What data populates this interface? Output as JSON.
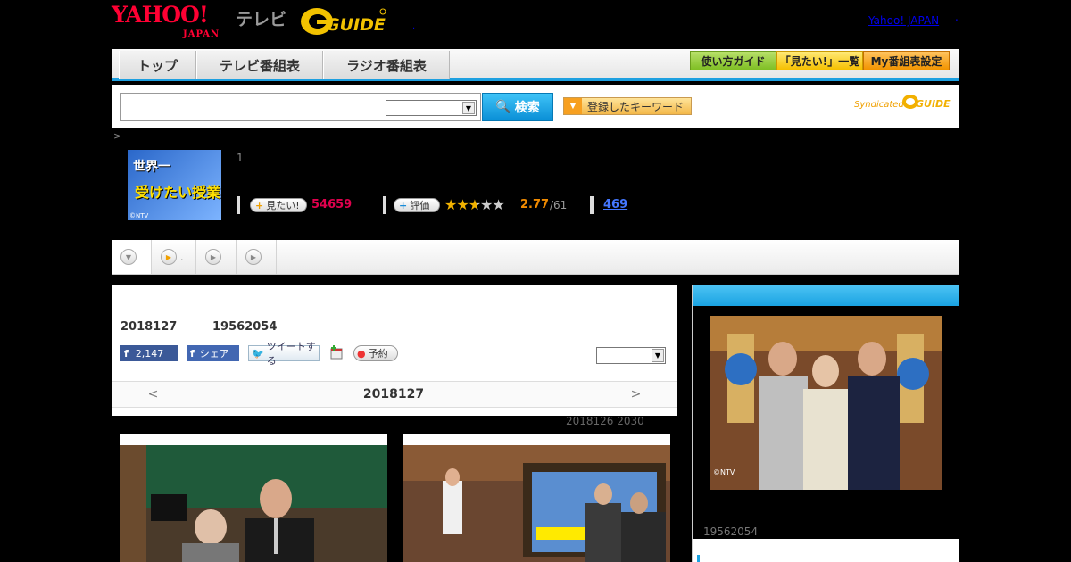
{
  "header": {
    "brand_yahoo": "YAHOO!",
    "brand_japan": "JAPAN",
    "brand_tv": "テレビ",
    "brand_gguide": "G-GUIDE",
    "link_yahoo_japan": "Yahoo! JAPAN",
    "link_dot": "."
  },
  "nav": {
    "tabs": [
      "トップ",
      "テレビ番組表",
      "ラジオ番組表"
    ],
    "buttons": [
      "使い方ガイド",
      "「見たい!」一覧",
      "My番組表設定"
    ]
  },
  "search": {
    "placeholder": "",
    "button_label": "検索",
    "keyword_button_label": "登録したキーワード",
    "syndicated_label": "Syndicated"
  },
  "breadcrumb": ">",
  "program": {
    "thumb_title_line1": "世界一",
    "thumb_title_line2": "受けたい授業",
    "thumb_copyright": "©NTV",
    "episode_number": "1",
    "want_label": "見たい!",
    "want_count": "54659",
    "rate_label": "評価",
    "rating_value": "2.77",
    "rating_count": "/61",
    "review_count": "469",
    "rating_stars": 2.77
  },
  "tabstrip": {
    "tab2_suffix": "."
  },
  "episode": {
    "date": "2018127",
    "id": "19562054",
    "fb_count": "2,147",
    "fb_share_label": "シェア",
    "tweet_label": "ツイートする",
    "reserve_label": "予約",
    "pager_prev": "<",
    "pager_current": "2018127",
    "pager_next": ">",
    "broadcast_info": "2018126  2030"
  },
  "sidebar": {
    "image_credit": "©NTV",
    "episode_id": "19562054"
  },
  "colors": {
    "accent_blue": "#1ea0e0",
    "want_red": "#e0004d",
    "rating_orange": "#f08a00",
    "yahoo_red": "#ff0033"
  }
}
